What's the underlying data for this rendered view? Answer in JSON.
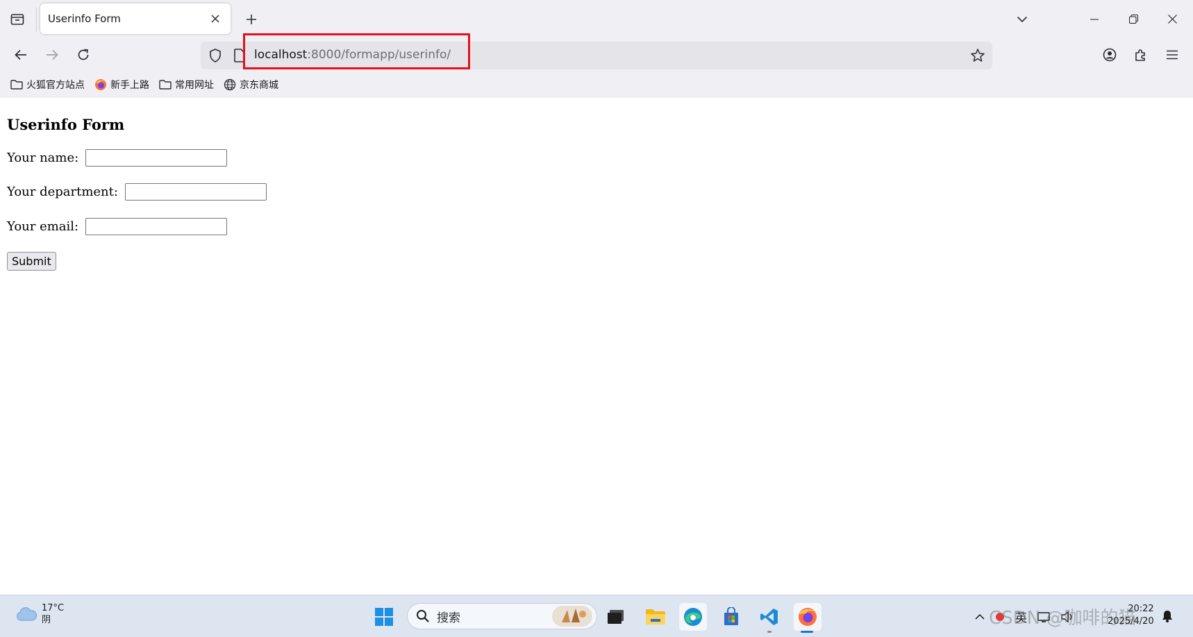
{
  "browser": {
    "tab_title": "Userinfo Form",
    "url_host": "localhost",
    "url_path": ":8000/formapp/userinfo/",
    "bookmarks": [
      {
        "label": "火狐官方站点",
        "icon": "folder-icon"
      },
      {
        "label": "新手上路",
        "icon": "firefox-icon"
      },
      {
        "label": "常用网址",
        "icon": "folder-icon"
      },
      {
        "label": "京东商城",
        "icon": "globe-icon"
      }
    ],
    "highlight_color": "#e3101c"
  },
  "page": {
    "heading": "Userinfo Form",
    "fields": [
      {
        "label": "Your name:",
        "value": ""
      },
      {
        "label": "Your department:",
        "value": ""
      },
      {
        "label": "Your email:",
        "value": ""
      }
    ],
    "submit_label": "Submit"
  },
  "taskbar": {
    "weather_temp": "17°C",
    "weather_desc": "阴",
    "search_placeholder": "搜索",
    "tray_lang": "英",
    "clock_time": "20:22",
    "clock_date": "2025/4/20",
    "watermark": "CSDN @咖啡的猫"
  }
}
